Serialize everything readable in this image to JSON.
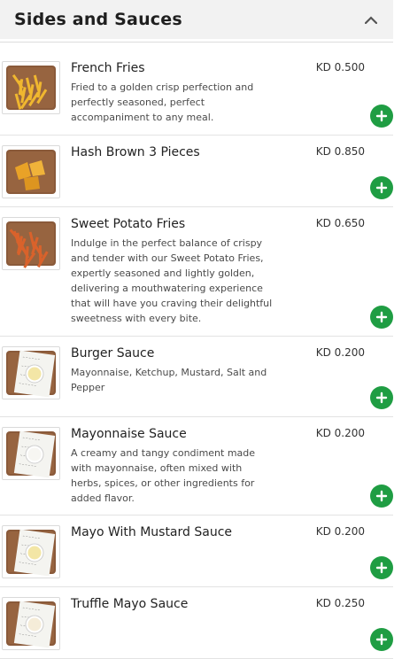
{
  "section": {
    "title": "Sides and Sauces",
    "toggle_icon": "chevron-up-icon"
  },
  "items": [
    {
      "name": "French Fries",
      "price": "KD 0.500",
      "description": "Fried to a golden crisp perfection and perfectly seasoned, perfect accompaniment to any meal.",
      "image": "fries"
    },
    {
      "name": "Hash Brown 3 Pieces",
      "price": "KD 0.850",
      "description": "",
      "image": "hashbrown"
    },
    {
      "name": "Sweet Potato Fries",
      "price": "KD 0.650",
      "description": "Indulge in the perfect balance of crispy and tender with our Sweet Potato Fries, expertly seasoned and lightly golden, delivering a mouthwatering experience that will have you craving their delightful sweetness with every bite.",
      "image": "sweetfries"
    },
    {
      "name": "Burger Sauce",
      "price": "KD 0.200",
      "description": "Mayonnaise, Ketchup, Mustard, Salt and Pepper",
      "image": "sauce-yellow"
    },
    {
      "name": "Mayonnaise Sauce",
      "price": "KD 0.200",
      "description": "A creamy and tangy condiment made with mayonnaise, often mixed with herbs, spices, or other ingredients for added flavor.",
      "image": "sauce-white"
    },
    {
      "name": "Mayo With Mustard Sauce",
      "price": "KD 0.200",
      "description": "",
      "image": "sauce-yellow"
    },
    {
      "name": "Truffle Mayo Sauce",
      "price": "KD 0.250",
      "description": "",
      "image": "sauce-cream"
    }
  ],
  "colors": {
    "add_button": "#1f9d43",
    "header_bg": "#f2f2f2",
    "divider": "#e3e3e3"
  }
}
